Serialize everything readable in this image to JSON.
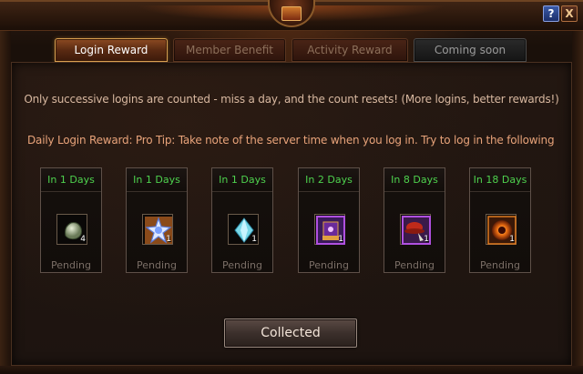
{
  "window": {
    "help_label": "?",
    "close_label": "X"
  },
  "tabs": [
    {
      "label": "Login Reward",
      "state": "active"
    },
    {
      "label": "Member Benefit",
      "state": "inactive"
    },
    {
      "label": "Activity Reward",
      "state": "inactive"
    },
    {
      "label": "Coming soon",
      "state": "disabled"
    }
  ],
  "notice": "Only successive logins are counted - miss a day, and the count resets! (More logins, better rewards!)",
  "tip": "Daily Login Reward:  Pro Tip: Take note of the server time when you log in. Try to log in the following",
  "rewards": [
    {
      "days": "In 1 Days",
      "item_icon": "stone-icon",
      "qty": "4",
      "status": "Pending"
    },
    {
      "days": "In 1 Days",
      "item_icon": "crystal-star-icon",
      "qty": "1",
      "status": "Pending"
    },
    {
      "days": "In 1 Days",
      "item_icon": "diamond-gem-icon",
      "qty": "1",
      "status": "Pending"
    },
    {
      "days": "In 2 Days",
      "item_icon": "spellbook-icon",
      "qty": "1",
      "status": "Pending"
    },
    {
      "days": "In 8 Days",
      "item_icon": "red-hat-icon",
      "qty": "1",
      "status": "Pending"
    },
    {
      "days": "In 18 Days",
      "item_icon": "fire-orb-icon",
      "qty": "1",
      "status": "Pending"
    }
  ],
  "collected_label": "Collected",
  "colors": {
    "days_green": "#4ed24e",
    "tip_orange": "#e8a37a",
    "notice_text": "#d8b8a0",
    "pending_gray": "#7a6e66"
  }
}
